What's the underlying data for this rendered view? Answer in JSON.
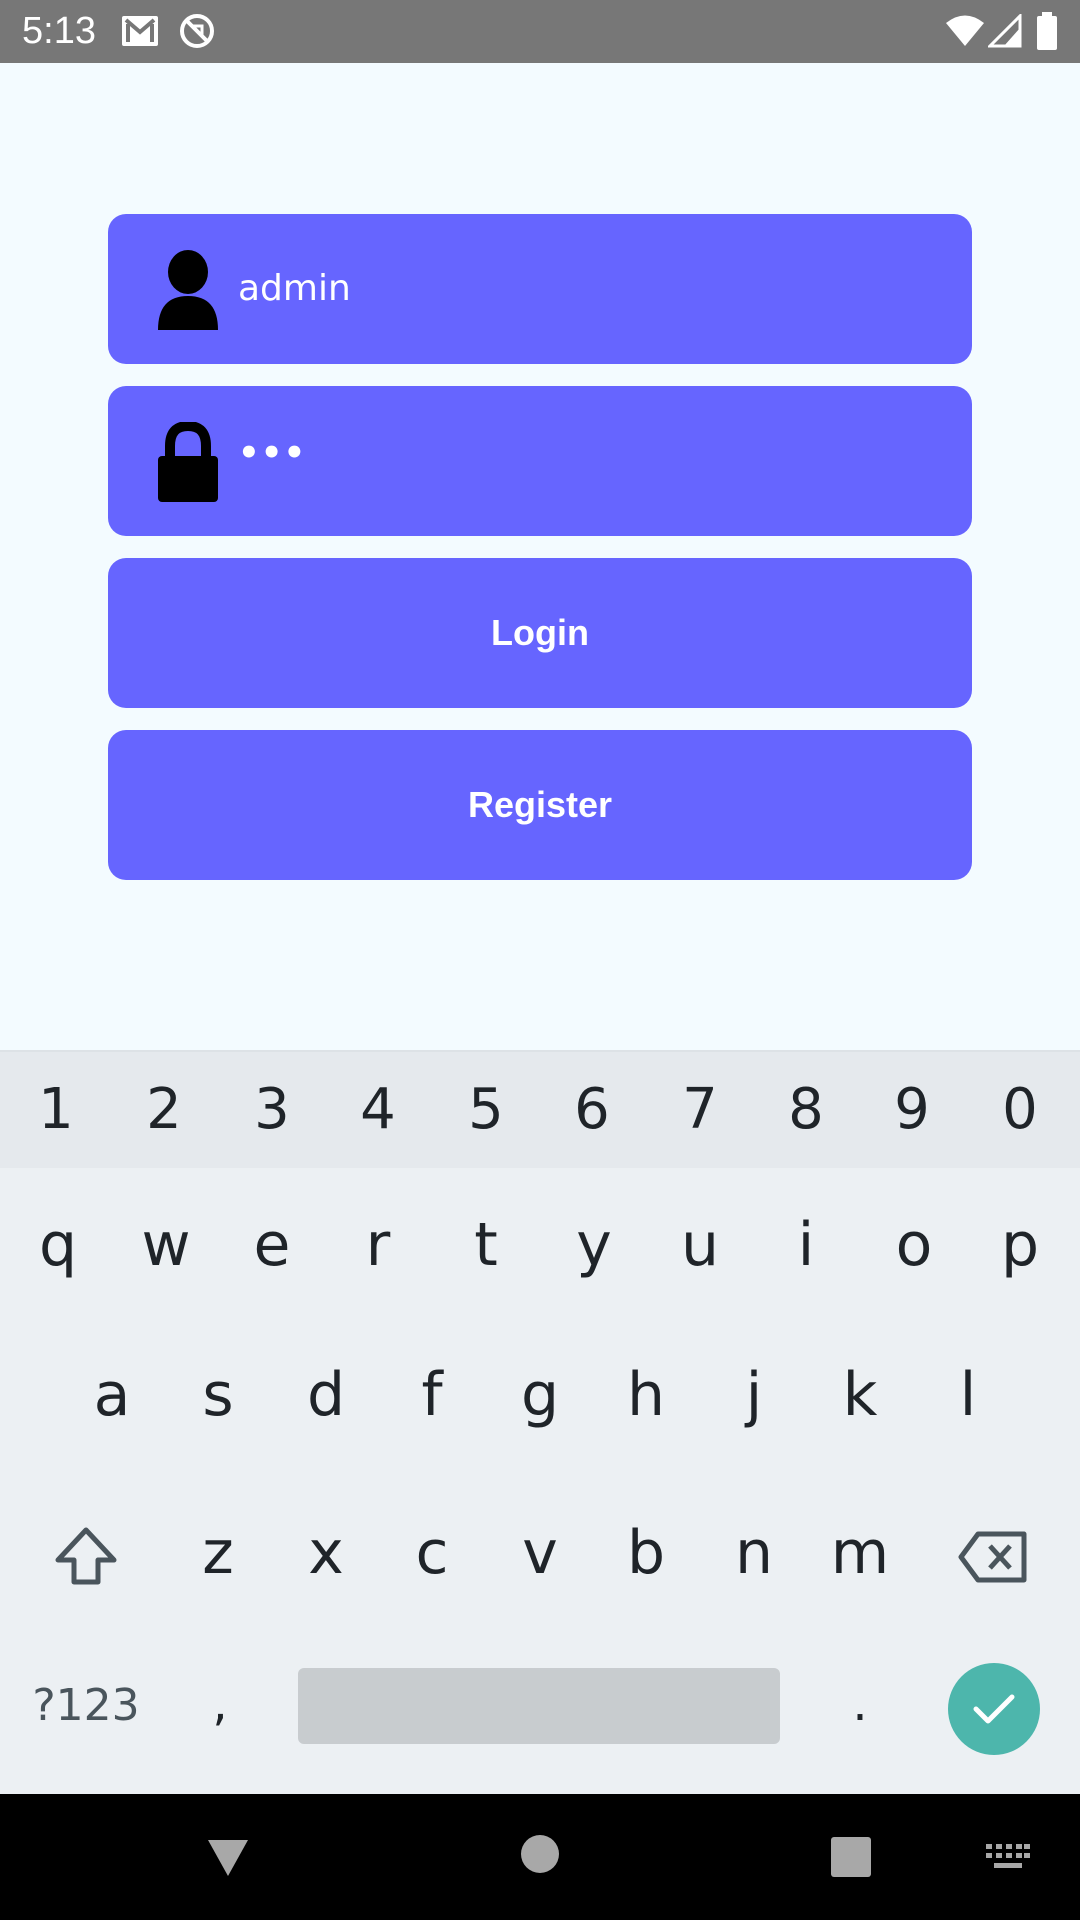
{
  "status_bar": {
    "time": "5:13",
    "left_icons": [
      "gmail-icon",
      "sync-off-icon"
    ],
    "right_icons": [
      "wifi-icon",
      "signal-icon",
      "battery-icon"
    ]
  },
  "login_form": {
    "username": {
      "value": "admin",
      "icon": "user-icon"
    },
    "password": {
      "value": "•••",
      "icon": "lock-icon"
    },
    "login_label": "Login",
    "register_label": "Register",
    "accent_color": "#6665ff"
  },
  "keyboard": {
    "number_row": [
      "1",
      "2",
      "3",
      "4",
      "5",
      "6",
      "7",
      "8",
      "9",
      "0"
    ],
    "row1": [
      "q",
      "w",
      "e",
      "r",
      "t",
      "y",
      "u",
      "i",
      "o",
      "p"
    ],
    "row2": [
      "a",
      "s",
      "d",
      "f",
      "g",
      "h",
      "j",
      "k",
      "l"
    ],
    "row3": [
      "z",
      "x",
      "c",
      "v",
      "b",
      "n",
      "m"
    ],
    "symbols_label": "?123",
    "comma": ",",
    "period": ".",
    "enter_color": "#4db6ac"
  },
  "nav_bar": {
    "icons": [
      "back-icon",
      "home-icon",
      "recents-icon",
      "keyboard-switch-icon"
    ]
  }
}
